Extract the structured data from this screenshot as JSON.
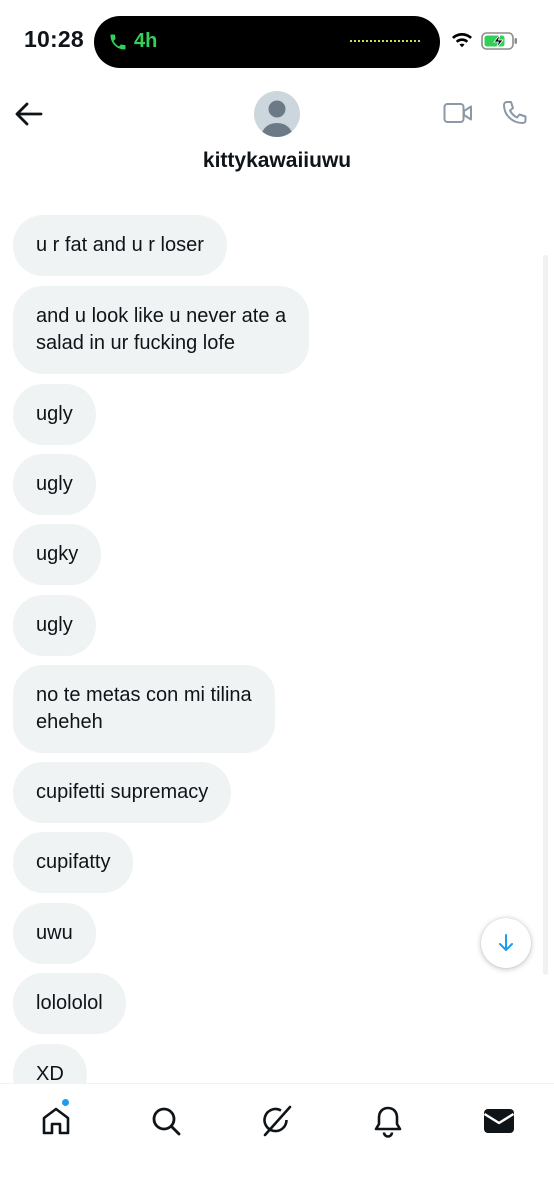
{
  "status_bar": {
    "time": "10:28",
    "call_duration": "4h",
    "call_color": "#31d158"
  },
  "header": {
    "username": "kittykawaiiuwu"
  },
  "messages": [
    "u r fat and u r loser",
    "and u look like u never ate a\nsalad in ur fucking lofe",
    "ugly",
    "ugly",
    "ugky",
    "ugly",
    "no te metas con mi tilina\neheheh",
    "cupifetti supremacy",
    "cupifatty",
    "uwu",
    "lolololol",
    "XD"
  ],
  "bottom_nav": {
    "items": [
      "home-icon",
      "search-icon",
      "grok-icon",
      "notifications-icon",
      "messages-icon"
    ],
    "home_has_notification": true
  },
  "colors": {
    "bubble_bg": "#eff3f4",
    "text": "#0f1419",
    "accent": "#1d9bf0"
  }
}
